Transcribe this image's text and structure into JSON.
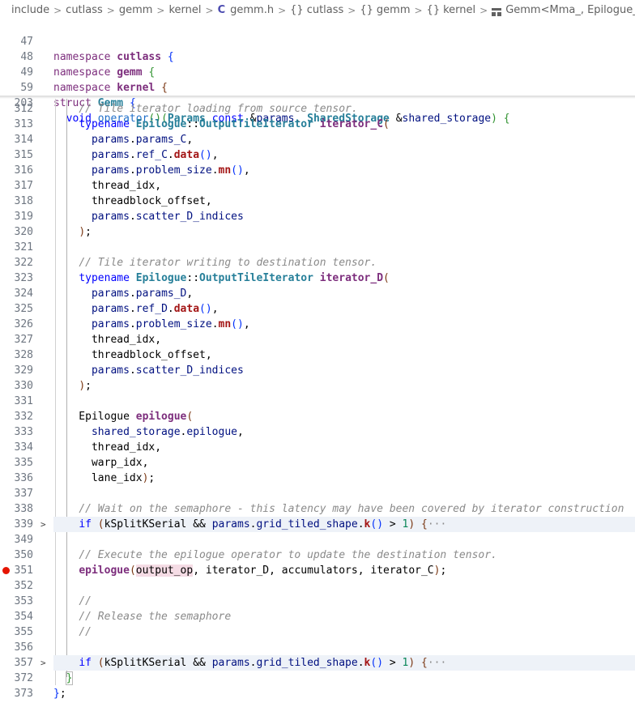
{
  "breadcrumb": {
    "items": [
      "include",
      "cutlass",
      "gemm",
      "kernel",
      "gemm.h",
      "cutlass",
      "gemm",
      "kernel",
      "Gemm<Mma_, Epilogue_, ThreadblockSw"
    ],
    "file_icon": "C"
  },
  "sticky_lines": [
    {
      "num": "47",
      "text": "namespace cutlass {"
    },
    {
      "num": "48",
      "text": "namespace gemm {"
    },
    {
      "num": "49",
      "text": "namespace kernel {"
    },
    {
      "num": "59",
      "text": "struct Gemm {"
    },
    {
      "num": "203",
      "text": "  void operator()(Params const &params, SharedStorage &shared_storage) {"
    }
  ],
  "lines": [
    {
      "num": "312",
      "text": "    // Tile iterator loading from source tensor."
    },
    {
      "num": "313",
      "text": "    typename Epilogue::OutputTileIterator iterator_C("
    },
    {
      "num": "314",
      "text": "      params.params_C,"
    },
    {
      "num": "315",
      "text": "      params.ref_C.data(),"
    },
    {
      "num": "316",
      "text": "      params.problem_size.mn(),"
    },
    {
      "num": "317",
      "text": "      thread_idx,"
    },
    {
      "num": "318",
      "text": "      threadblock_offset,"
    },
    {
      "num": "319",
      "text": "      params.scatter_D_indices"
    },
    {
      "num": "320",
      "text": "    );"
    },
    {
      "num": "321",
      "text": ""
    },
    {
      "num": "322",
      "text": "    // Tile iterator writing to destination tensor."
    },
    {
      "num": "323",
      "text": "    typename Epilogue::OutputTileIterator iterator_D("
    },
    {
      "num": "324",
      "text": "      params.params_D,"
    },
    {
      "num": "325",
      "text": "      params.ref_D.data(),"
    },
    {
      "num": "326",
      "text": "      params.problem_size.mn(),"
    },
    {
      "num": "327",
      "text": "      thread_idx,"
    },
    {
      "num": "328",
      "text": "      threadblock_offset,"
    },
    {
      "num": "329",
      "text": "      params.scatter_D_indices"
    },
    {
      "num": "330",
      "text": "    );"
    },
    {
      "num": "331",
      "text": ""
    },
    {
      "num": "332",
      "text": "    Epilogue epilogue("
    },
    {
      "num": "333",
      "text": "      shared_storage.epilogue,"
    },
    {
      "num": "334",
      "text": "      thread_idx,"
    },
    {
      "num": "335",
      "text": "      warp_idx,"
    },
    {
      "num": "336",
      "text": "      lane_idx);"
    },
    {
      "num": "337",
      "text": ""
    },
    {
      "num": "338",
      "text": "    // Wait on the semaphore - this latency may have been covered by iterator construction"
    },
    {
      "num": "339",
      "text": "    if (kSplitKSerial && params.grid_tiled_shape.k() > 1) {···"
    },
    {
      "num": "349",
      "text": ""
    },
    {
      "num": "350",
      "text": "    // Execute the epilogue operator to update the destination tensor."
    },
    {
      "num": "351",
      "text": "    epilogue(output_op, iterator_D, accumulators, iterator_C);"
    },
    {
      "num": "352",
      "text": ""
    },
    {
      "num": "353",
      "text": "    //"
    },
    {
      "num": "354",
      "text": "    // Release the semaphore"
    },
    {
      "num": "355",
      "text": "    //"
    },
    {
      "num": "356",
      "text": ""
    },
    {
      "num": "357",
      "text": "    if (kSplitKSerial && params.grid_tiled_shape.k() > 1) {···"
    },
    {
      "num": "372",
      "text": "  }"
    },
    {
      "num": "373",
      "text": "};"
    }
  ],
  "folded_lines": [
    "339",
    "357"
  ],
  "breakpoint_line": "351"
}
